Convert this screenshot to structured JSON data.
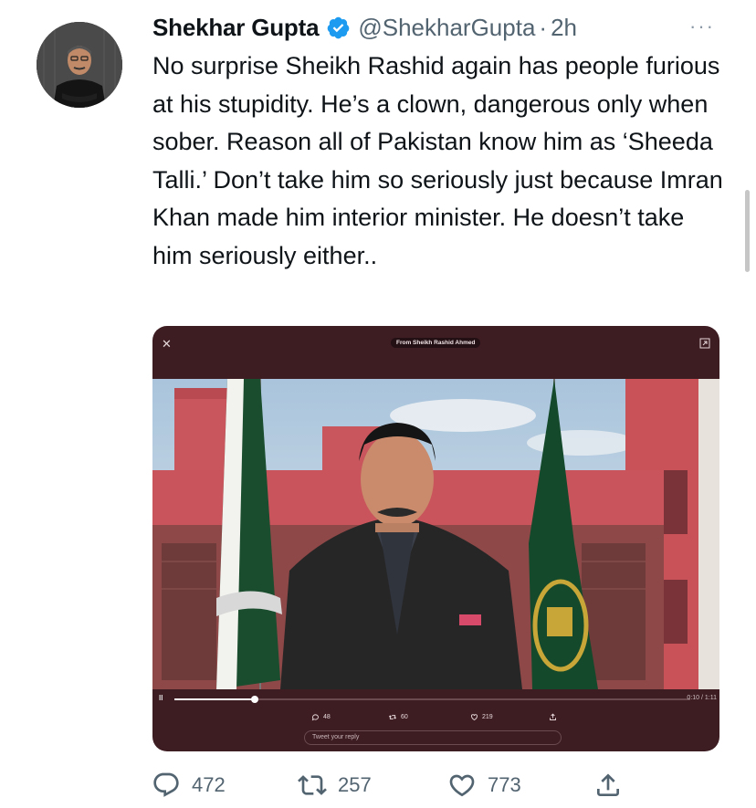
{
  "tweet": {
    "author_name": "Shekhar Gupta",
    "author_handle": "@ShekharGupta",
    "separator": "·",
    "time": "2h",
    "more": "···",
    "text": "No surprise Sheikh Rashid again has people furious at his stupidity. He’s a clown, dangerous only when sober. Reason all of Pakistan know him as ‘Sheeda Talli.’ Don’t take him so seriously just because Imran Khan made him interior minister. He doesn’t take him seriously either..",
    "icons": {
      "verified": "verified-badge-icon",
      "avatar": "avatar"
    }
  },
  "media": {
    "close": "✕",
    "from_label": "From Sheikh Rashid Ahmed",
    "pause": "II",
    "time": "0:10 / 1:11",
    "progress": 0.155,
    "replies": "48",
    "retweets": "60",
    "likes": "219",
    "reply_placeholder": "Tweet your reply"
  },
  "actions": {
    "replies": "472",
    "retweets": "257",
    "likes": "773"
  },
  "colors": {
    "accent": "#1d9bf0",
    "text": "#0f1419",
    "secondary": "#536471",
    "media_bg": "#3d1c22"
  }
}
